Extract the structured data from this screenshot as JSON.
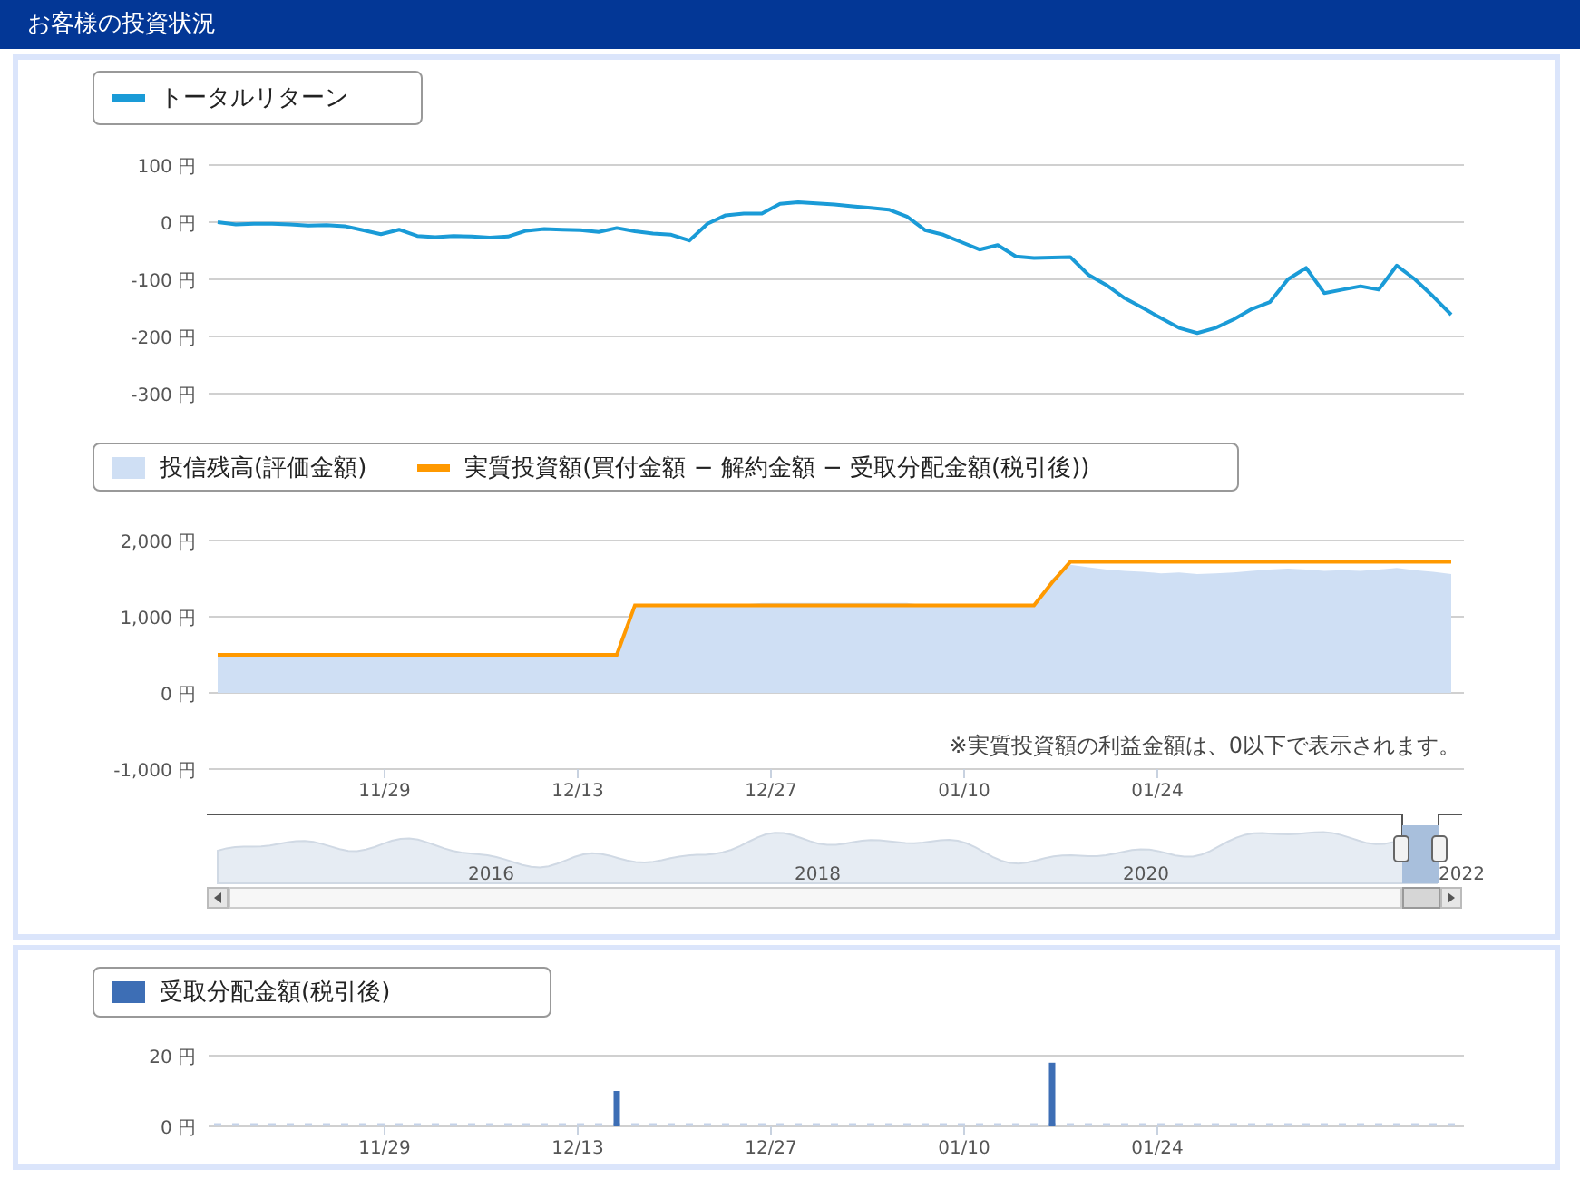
{
  "header": {
    "title": "お客様の投資状況"
  },
  "return_chart": {
    "chart_data": {
      "type": "line",
      "grid": true,
      "ylim": [
        -300,
        100
      ],
      "yticks": [
        {
          "value": 100,
          "label": "100 円"
        },
        {
          "value": 0,
          "label": "0 円"
        },
        {
          "value": -100,
          "label": "-100 円"
        },
        {
          "value": -200,
          "label": "-200 円"
        },
        {
          "value": -300,
          "label": "-300 円"
        }
      ],
      "series": [
        {
          "name": "トータルリターン",
          "color": "#1a9bd7",
          "values": [
            0,
            -4,
            -3,
            -3,
            -4,
            -6,
            -5,
            -7,
            -14,
            -21,
            -13,
            -24,
            -26,
            -24,
            -25,
            -27,
            -25,
            -15,
            -12,
            -13,
            -14,
            -17,
            -10,
            -16,
            -20,
            -22,
            -32,
            -3,
            12,
            15,
            15,
            32,
            35,
            33,
            31,
            28,
            25,
            22,
            10,
            -14,
            -22,
            -35,
            -48,
            -40,
            -60,
            -63,
            -62,
            -61,
            -92,
            -110,
            -133,
            -150,
            -168,
            -185,
            -194,
            -185,
            -170,
            -152,
            -140,
            -100,
            -80,
            -124,
            -118,
            -112,
            -118,
            -76,
            -100,
            -130,
            -162
          ]
        }
      ]
    }
  },
  "balance_chart": {
    "chart_data": {
      "type": "area",
      "grid": true,
      "ylim": [
        -1000,
        2000
      ],
      "yticks": [
        {
          "value": 2000,
          "label": "2,000 円"
        },
        {
          "value": 1000,
          "label": "1,000 円"
        },
        {
          "value": 0,
          "label": "0 円"
        },
        {
          "value": -1000,
          "label": "-1,000 円"
        }
      ],
      "series": [
        {
          "name": "投信残高(評価金額)",
          "type": "area",
          "color": "#cfdff4",
          "values": [
            500,
            500,
            500,
            500,
            500,
            500,
            500,
            500,
            500,
            500,
            500,
            500,
            500,
            500,
            500,
            500,
            500,
            500,
            500,
            500,
            500,
            500,
            500,
            1150,
            1160,
            1160,
            1160,
            1160,
            1160,
            1160,
            1180,
            1180,
            1180,
            1180,
            1180,
            1180,
            1180,
            1180,
            1180,
            1150,
            1150,
            1150,
            1150,
            1150,
            1150,
            1150,
            1500,
            1680,
            1650,
            1620,
            1600,
            1590,
            1570,
            1580,
            1560,
            1570,
            1580,
            1600,
            1620,
            1630,
            1620,
            1600,
            1610,
            1600,
            1620,
            1640,
            1610,
            1590,
            1560
          ]
        },
        {
          "name": "実質投資額(買付金額 − 解約金額 − 受取分配金額(税引後))",
          "type": "line",
          "color": "#ff9900",
          "values": [
            500,
            500,
            500,
            500,
            500,
            500,
            500,
            500,
            500,
            500,
            500,
            500,
            500,
            500,
            500,
            500,
            500,
            500,
            500,
            500,
            500,
            500,
            500,
            1150,
            1150,
            1150,
            1150,
            1150,
            1150,
            1150,
            1150,
            1150,
            1150,
            1150,
            1150,
            1150,
            1150,
            1150,
            1150,
            1150,
            1150,
            1150,
            1150,
            1150,
            1150,
            1150,
            1450,
            1720,
            1720,
            1720,
            1720,
            1720,
            1720,
            1720,
            1720,
            1720,
            1720,
            1720,
            1720,
            1720,
            1720,
            1720,
            1720,
            1720,
            1720,
            1720,
            1720,
            1720,
            1720
          ]
        }
      ],
      "annotations": [
        "※実質投資額の利益金額は、0以下で表示されます。"
      ]
    },
    "date_labels": [
      "11/29",
      "12/13",
      "12/27",
      "01/10",
      "01/24"
    ],
    "navigator": {
      "year_labels": [
        "2016",
        "2018",
        "2020",
        "2022"
      ]
    }
  },
  "dividend_chart": {
    "chart_data": {
      "type": "bar",
      "ylim": [
        0,
        20
      ],
      "yticks": [
        {
          "value": 20,
          "label": "20 円"
        },
        {
          "value": 0,
          "label": "0 円"
        }
      ],
      "series": [
        {
          "name": "受取分配金額(税引後)",
          "color": "#3d6eb5",
          "values": [
            0,
            0,
            0,
            0,
            0,
            0,
            0,
            0,
            0,
            0,
            0,
            0,
            0,
            0,
            0,
            0,
            0,
            0,
            0,
            0,
            0,
            0,
            10,
            0,
            0,
            0,
            0,
            0,
            0,
            0,
            0,
            0,
            0,
            0,
            0,
            0,
            0,
            0,
            0,
            0,
            0,
            0,
            0,
            0,
            0,
            0,
            18,
            0,
            0,
            0,
            0,
            0,
            0,
            0,
            0,
            0,
            0,
            0,
            0,
            0,
            0,
            0,
            0,
            0,
            0,
            0,
            0,
            0,
            0
          ]
        }
      ]
    },
    "date_labels": [
      "11/29",
      "12/13",
      "12/27",
      "01/10",
      "01/24"
    ]
  }
}
